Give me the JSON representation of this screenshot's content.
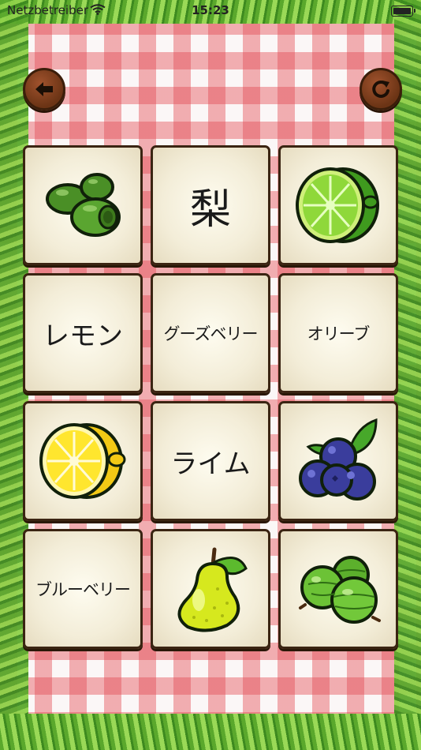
{
  "status_bar": {
    "carrier": "Netzbetreiber",
    "time": "15:23"
  },
  "toolbar": {
    "back_icon": "arrow-left-icon",
    "reload_icon": "reload-icon"
  },
  "cards": [
    {
      "kind": "image",
      "fruit": "olive"
    },
    {
      "kind": "text",
      "label": "梨"
    },
    {
      "kind": "image",
      "fruit": "lime"
    },
    {
      "kind": "text",
      "label": "レモン"
    },
    {
      "kind": "text",
      "label": "グーズベリー"
    },
    {
      "kind": "text",
      "label": "オリーブ"
    },
    {
      "kind": "image",
      "fruit": "lemon"
    },
    {
      "kind": "text",
      "label": "ライム"
    },
    {
      "kind": "image",
      "fruit": "blueberry"
    },
    {
      "kind": "text",
      "label": "ブルーベリー"
    },
    {
      "kind": "image",
      "fruit": "pear"
    },
    {
      "kind": "image",
      "fruit": "gooseberry"
    }
  ],
  "colors": {
    "tablecloth_red": "#e24850",
    "card_bg": "#f3edd8",
    "card_border": "#3a2412",
    "button_wood": "#8b4513",
    "grass": "#5aa82c"
  }
}
